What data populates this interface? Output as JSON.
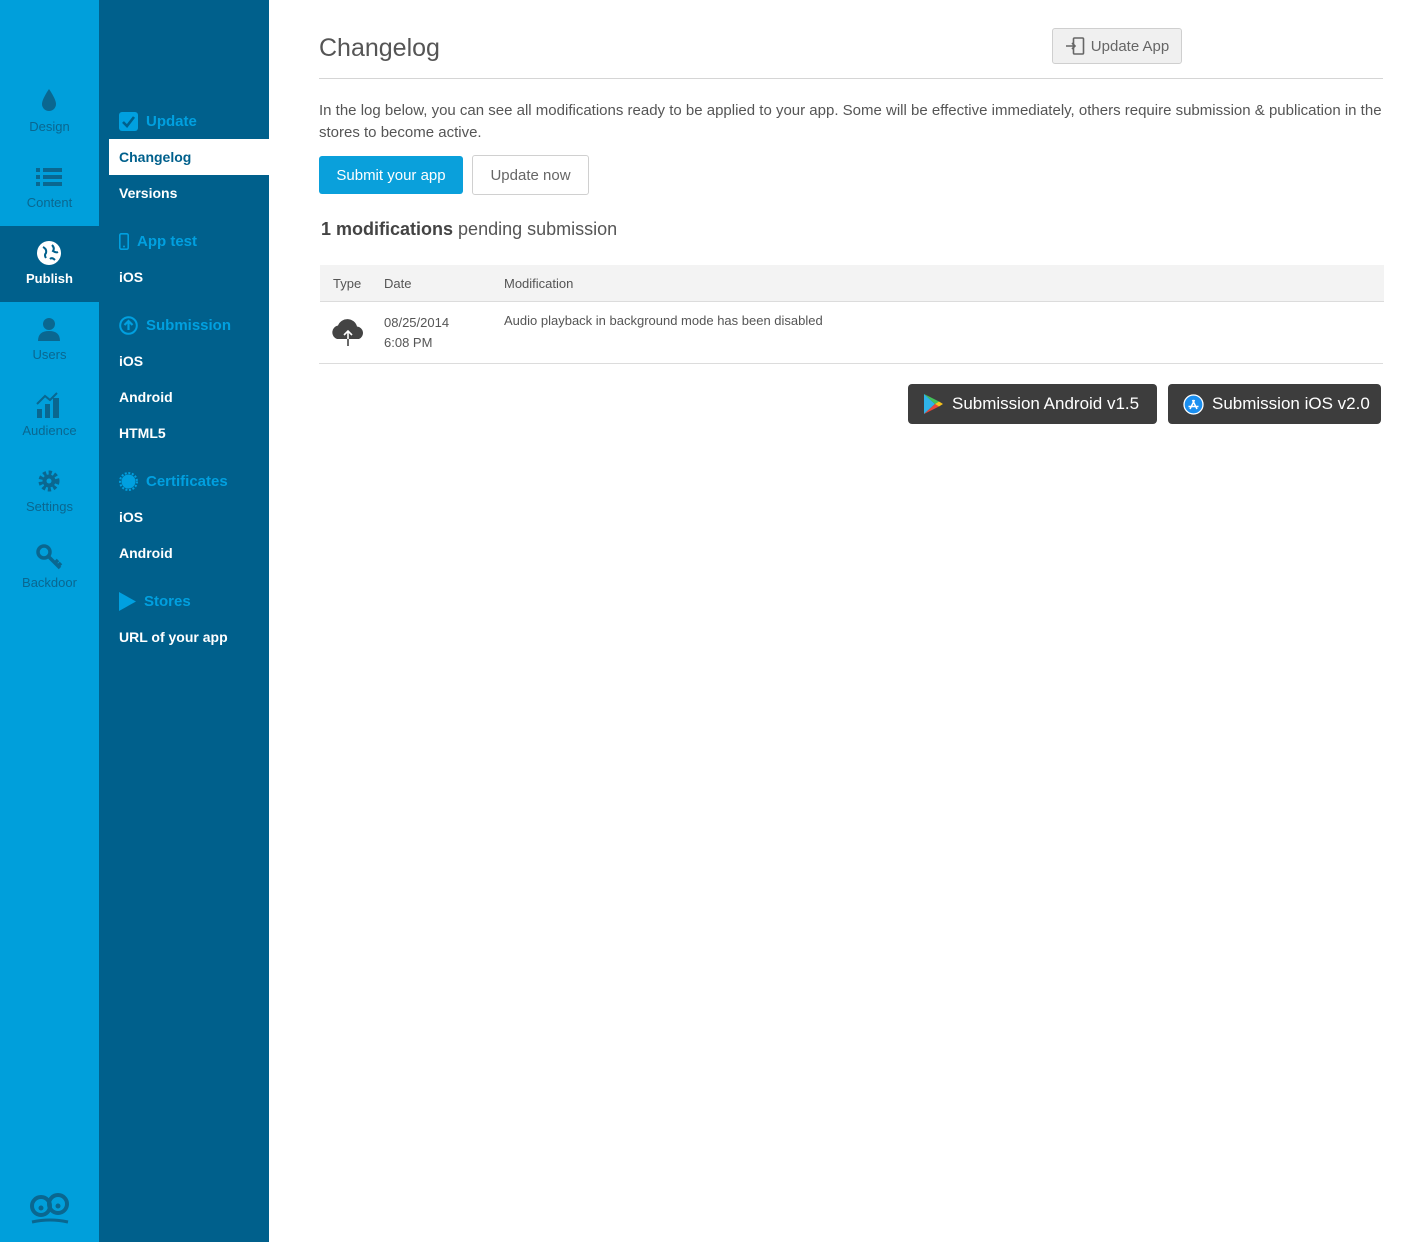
{
  "rail": {
    "items": [
      {
        "key": "design",
        "label": "Design",
        "icon": "drop-icon"
      },
      {
        "key": "content",
        "label": "Content",
        "icon": "list-icon"
      },
      {
        "key": "publish",
        "label": "Publish",
        "icon": "globe-icon",
        "active": true
      },
      {
        "key": "users",
        "label": "Users",
        "icon": "user-icon"
      },
      {
        "key": "audience",
        "label": "Audience",
        "icon": "bar-chart-icon"
      },
      {
        "key": "settings",
        "label": "Settings",
        "icon": "gear-icon"
      },
      {
        "key": "backdoor",
        "label": "Backdoor",
        "icon": "key-icon"
      }
    ]
  },
  "subnav": {
    "update": {
      "title": "Update",
      "links": [
        "Changelog",
        "Versions"
      ]
    },
    "app_test": {
      "title": "App test",
      "links": [
        "iOS"
      ]
    },
    "submission": {
      "title": "Submission",
      "links": [
        "iOS",
        "Android",
        "HTML5"
      ]
    },
    "certificates": {
      "title": "Certificates",
      "links": [
        "iOS",
        "Android"
      ]
    },
    "stores": {
      "title": "Stores",
      "links": [
        "URL of your app"
      ]
    },
    "active_link": "Changelog"
  },
  "main": {
    "title": "Changelog",
    "update_app_label": "Update App",
    "intro": "In the log below, you can see all modifications ready to be applied to your app. Some will be effective immediately, others require submission & publication in the stores to become active.",
    "submit_label": "Submit your app",
    "update_now_label": "Update now",
    "pending_count_text": "1 modifications",
    "pending_suffix": "pending submission",
    "table": {
      "headers": {
        "type": "Type",
        "date": "Date",
        "modification": "Modification"
      },
      "rows": [
        {
          "type_icon": "cloud-upload-icon",
          "date": "08/25/2014",
          "time": "6:08 PM",
          "modification": "Audio playback in background mode has been disabled"
        }
      ]
    },
    "store_buttons": {
      "android": "Submission Android v1.5",
      "ios": "Submission iOS v2.0"
    }
  },
  "colors": {
    "rail_bg": "#009fdb",
    "subnav_bg": "#00608c",
    "accent": "#0aa0db",
    "store_button_bg": "#3d3d3d"
  }
}
